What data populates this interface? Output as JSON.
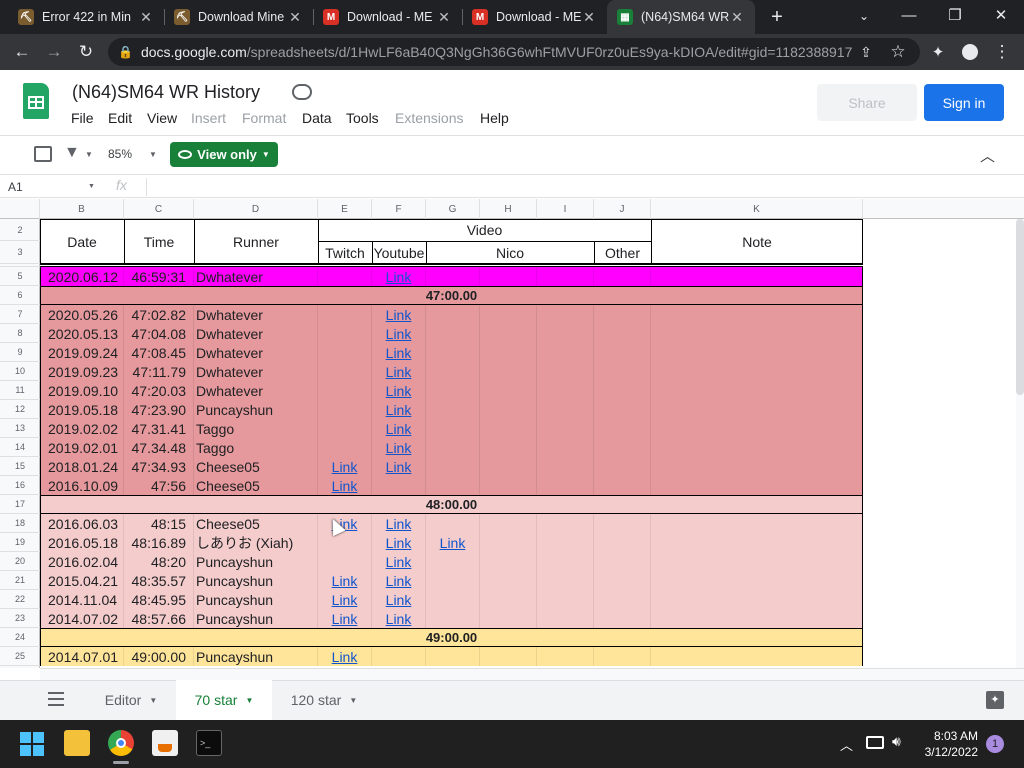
{
  "browser": {
    "tabs": [
      {
        "title": "Error 422 in Min",
        "active": false
      },
      {
        "title": "Download Mine",
        "active": false
      },
      {
        "title": "Download - ME",
        "active": false
      },
      {
        "title": "Download - ME",
        "active": false
      },
      {
        "title": "(N64)SM64 WR",
        "active": true
      }
    ],
    "url_domain": "docs.google.com",
    "url_path": "/spreadsheets/d/1HwLF6aB40Q3NgGh36G6whFtMVUF0rz0uEs9ya-kDIOA/edit#gid=1182388917"
  },
  "doc": {
    "title": "(N64)SM64 WR History",
    "menus": [
      "File",
      "Edit",
      "View",
      "Insert",
      "Format",
      "Data",
      "Tools",
      "Extensions",
      "Help"
    ],
    "share_label": "Share",
    "signin_label": "Sign in"
  },
  "toolbar": {
    "zoom": "85%",
    "view_only_label": "View only"
  },
  "formula_bar": {
    "cell_ref": "A1",
    "fx": "fx"
  },
  "columns": [
    "B",
    "C",
    "D",
    "E",
    "F",
    "G",
    "H",
    "I",
    "J",
    "K"
  ],
  "header": {
    "date": "Date",
    "time": "Time",
    "runner": "Runner",
    "video": "Video",
    "twitch": "Twitch",
    "youtube": "Youtube",
    "nico": "Nico",
    "other": "Other",
    "note": "Note"
  },
  "rows": [
    {
      "n": "5",
      "type": "record",
      "color": "#ff00ff",
      "date": "2020.06.12",
      "time": "46:59:31",
      "runner": "Dwhatever",
      "twitch": "",
      "youtube": "Link",
      "nico": ""
    },
    {
      "n": "6",
      "type": "band",
      "color": "#e6999c",
      "label": "47:00.00"
    },
    {
      "n": "7",
      "type": "record",
      "color": "#e6999c",
      "date": "2020.05.26",
      "time": "47:02.82",
      "runner": "Dwhatever",
      "twitch": "",
      "youtube": "Link",
      "nico": ""
    },
    {
      "n": "8",
      "type": "record",
      "color": "#e6999c",
      "date": "2020.05.13",
      "time": "47:04.08",
      "runner": "Dwhatever",
      "twitch": "",
      "youtube": "Link",
      "nico": ""
    },
    {
      "n": "9",
      "type": "record",
      "color": "#e6999c",
      "date": "2019.09.24",
      "time": "47:08.45",
      "runner": "Dwhatever",
      "twitch": "",
      "youtube": "Link",
      "nico": ""
    },
    {
      "n": "10",
      "type": "record",
      "color": "#e6999c",
      "date": "2019.09.23",
      "time": "47:11.79",
      "runner": "Dwhatever",
      "twitch": "",
      "youtube": "Link",
      "nico": ""
    },
    {
      "n": "11",
      "type": "record",
      "color": "#e6999c",
      "date": "2019.09.10",
      "time": "47:20.03",
      "runner": "Dwhatever",
      "twitch": "",
      "youtube": "Link",
      "nico": ""
    },
    {
      "n": "12",
      "type": "record",
      "color": "#e6999c",
      "date": "2019.05.18",
      "time": "47:23.90",
      "runner": "Puncayshun",
      "twitch": "",
      "youtube": "Link",
      "nico": ""
    },
    {
      "n": "13",
      "type": "record",
      "color": "#e6999c",
      "date": "2019.02.02",
      "time": "47.31.41",
      "runner": "Taggo",
      "twitch": "",
      "youtube": "Link",
      "nico": ""
    },
    {
      "n": "14",
      "type": "record",
      "color": "#e6999c",
      "date": "2019.02.01",
      "time": "47.34.48",
      "runner": "Taggo",
      "twitch": "",
      "youtube": "Link",
      "nico": ""
    },
    {
      "n": "15",
      "type": "record",
      "color": "#e6999c",
      "date": "2018.01.24",
      "time": "47:34.93",
      "runner": "Cheese05",
      "twitch": "Link",
      "youtube": "Link",
      "nico": ""
    },
    {
      "n": "16",
      "type": "record",
      "color": "#e6999c",
      "date": "2016.10.09",
      "time": "47:56",
      "runner": "Cheese05",
      "twitch": "Link",
      "youtube": "",
      "nico": ""
    },
    {
      "n": "17",
      "type": "band",
      "color": "#f4cccc",
      "label": "48:00.00"
    },
    {
      "n": "18",
      "type": "record",
      "color": "#f4cccc",
      "date": "2016.06.03",
      "time": "48:15",
      "runner": "Cheese05",
      "twitch": "Link",
      "youtube": "Link",
      "nico": ""
    },
    {
      "n": "19",
      "type": "record",
      "color": "#f4cccc",
      "date": "2016.05.18",
      "time": "48:16.89",
      "runner": "しありお (Xiah)",
      "twitch": "",
      "youtube": "Link",
      "nico": "Link"
    },
    {
      "n": "20",
      "type": "record",
      "color": "#f4cccc",
      "date": "2016.02.04",
      "time": "48:20",
      "runner": "Puncayshun",
      "twitch": "",
      "youtube": "Link",
      "nico": ""
    },
    {
      "n": "21",
      "type": "record",
      "color": "#f4cccc",
      "date": "2015.04.21",
      "time": "48:35.57",
      "runner": "Puncayshun",
      "twitch": "Link",
      "youtube": "Link",
      "nico": ""
    },
    {
      "n": "22",
      "type": "record",
      "color": "#f4cccc",
      "date": "2014.11.04",
      "time": "48:45.95",
      "runner": "Puncayshun",
      "twitch": "Link",
      "youtube": "Link",
      "nico": ""
    },
    {
      "n": "23",
      "type": "record",
      "color": "#f4cccc",
      "date": "2014.07.02",
      "time": "48:57.66",
      "runner": "Puncayshun",
      "twitch": "Link",
      "youtube": "Link",
      "nico": ""
    },
    {
      "n": "24",
      "type": "band",
      "color": "#ffe599",
      "label": "49:00.00"
    },
    {
      "n": "25",
      "type": "record",
      "color": "#ffe599",
      "date": "2014.07.01",
      "time": "49:00.00",
      "runner": "Puncayshun",
      "twitch": "Link",
      "youtube": "",
      "nico": ""
    }
  ],
  "sheet_tabs": [
    {
      "label": "Editor",
      "active": false
    },
    {
      "label": "70 star",
      "active": true
    },
    {
      "label": "120 star",
      "active": false
    }
  ],
  "taskbar": {
    "time": "8:03 AM",
    "date": "3/12/2022",
    "notification_count": "1"
  }
}
